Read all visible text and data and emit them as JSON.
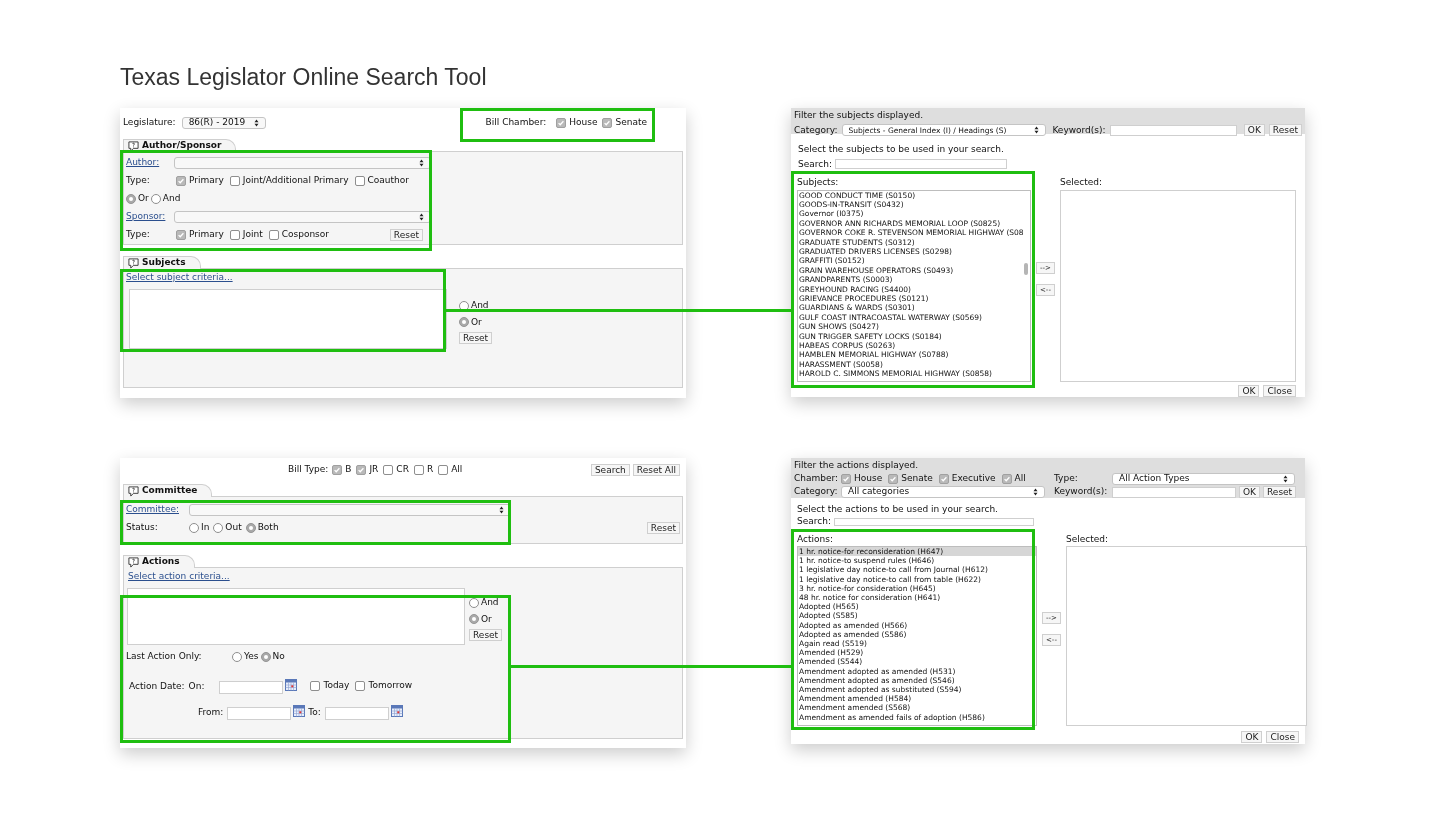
{
  "title": "Texas Legislator Online Search Tool",
  "search_form": {
    "legislature_label": "Legislature:",
    "legislature_value": "86(R) - 2019",
    "bill_chamber_label": "Bill Chamber:",
    "bill_chambers": [
      {
        "label": "House",
        "checked": true
      },
      {
        "label": "Senate",
        "checked": true
      }
    ],
    "author_sponsor": {
      "tab": "Author/Sponsor",
      "author_label": "Author:",
      "author_type_label": "Type:",
      "author_types": [
        {
          "label": "Primary",
          "checked": true
        },
        {
          "label": "Joint/Additional Primary",
          "checked": false
        },
        {
          "label": "Coauthor",
          "checked": false
        }
      ],
      "logic": [
        {
          "label": "Or",
          "selected": true
        },
        {
          "label": "And",
          "selected": false
        }
      ],
      "sponsor_label": "Sponsor:",
      "sponsor_type_label": "Type:",
      "sponsor_types": [
        {
          "label": "Primary",
          "checked": true
        },
        {
          "label": "Joint",
          "checked": false
        },
        {
          "label": "Cosponsor",
          "checked": false
        }
      ],
      "reset": "Reset"
    },
    "subjects": {
      "tab": "Subjects",
      "link": "Select subject criteria...",
      "logic": [
        {
          "label": "And",
          "selected": false
        },
        {
          "label": "Or",
          "selected": true
        }
      ],
      "reset": "Reset"
    }
  },
  "subjects_dialog": {
    "filter_title": "Filter the subjects displayed.",
    "category_label": "Category:",
    "category_value": "Subjects - General Index (I) / Headings (S)",
    "keyword_label": "Keyword(s):",
    "filter_ok": "OK",
    "filter_reset": "Reset",
    "instruction": "Select the subjects to be used in your search.",
    "search_label": "Search:",
    "list_label": "Subjects:",
    "items": [
      {
        "label": "GOOD CONDUCT TIME (S0150)",
        "selected": false
      },
      {
        "label": "GOODS-IN-TRANSIT (S0432)",
        "selected": false
      },
      {
        "label": "Governor (I0375)",
        "selected": false
      },
      {
        "label": "GOVERNOR ANN RICHARDS MEMORIAL LOOP (S0825)",
        "selected": false
      },
      {
        "label": "GOVERNOR COKE R. STEVENSON MEMORIAL HIGHWAY (S08",
        "selected": false
      },
      {
        "label": "GRADUATE STUDENTS (S0312)",
        "selected": false
      },
      {
        "label": "GRADUATED DRIVERS LICENSES (S0298)",
        "selected": false
      },
      {
        "label": "GRAFFITI (S0152)",
        "selected": false
      },
      {
        "label": "GRAIN WAREHOUSE OPERATORS (S0493)",
        "selected": false
      },
      {
        "label": "GRANDPARENTS (S0003)",
        "selected": false
      },
      {
        "label": "GREYHOUND RACING (S4400)",
        "selected": false
      },
      {
        "label": "GRIEVANCE PROCEDURES (S0121)",
        "selected": false
      },
      {
        "label": "GUARDIANS & WARDS (S0301)",
        "selected": false
      },
      {
        "label": "GULF COAST INTRACOASTAL WATERWAY (S0569)",
        "selected": false
      },
      {
        "label": "GUN SHOWS (S0427)",
        "selected": false
      },
      {
        "label": "GUN TRIGGER SAFETY LOCKS (S0184)",
        "selected": false
      },
      {
        "label": "HABEAS CORPUS (S0263)",
        "selected": false
      },
      {
        "label": "HAMBLEN MEMORIAL HIGHWAY (S0788)",
        "selected": false
      },
      {
        "label": "HARASSMENT (S0058)",
        "selected": false
      },
      {
        "label": "HAROLD C. SIMMONS MEMORIAL HIGHWAY (S0858)",
        "selected": false
      }
    ],
    "add": "-->",
    "remove": "<--",
    "selected_label": "Selected:",
    "ok": "OK",
    "close": "Close"
  },
  "search_form_lower": {
    "bill_type_label": "Bill Type:",
    "bill_types": [
      {
        "label": "B",
        "checked": true
      },
      {
        "label": "JR",
        "checked": true
      },
      {
        "label": "CR",
        "checked": false
      },
      {
        "label": "R",
        "checked": false
      },
      {
        "label": "All",
        "checked": false
      }
    ],
    "search": "Search",
    "reset_all": "Reset All",
    "committee": {
      "tab": "Committee",
      "label": "Committee:",
      "status_label": "Status:",
      "status": [
        {
          "label": "In",
          "selected": false
        },
        {
          "label": "Out",
          "selected": false
        },
        {
          "label": "Both",
          "selected": true
        }
      ],
      "reset": "Reset"
    },
    "actions": {
      "tab": "Actions",
      "link": "Select action criteria...",
      "logic": [
        {
          "label": "And",
          "selected": false
        },
        {
          "label": "Or",
          "selected": true
        }
      ],
      "reset": "Reset",
      "last_action_label": "Last Action Only:",
      "last_action": [
        {
          "label": "Yes",
          "selected": false
        },
        {
          "label": "No",
          "selected": true
        }
      ],
      "date_label": "Action Date:",
      "on_label": "On:",
      "today": {
        "label": "Today",
        "checked": false
      },
      "tomorrow": {
        "label": "Tomorrow",
        "checked": false
      },
      "from_label": "From:",
      "to_label": "To:"
    }
  },
  "actions_dialog": {
    "filter_title": "Filter the actions displayed.",
    "chamber_label": "Chamber:",
    "chambers": [
      {
        "label": "House",
        "checked": true
      },
      {
        "label": "Senate",
        "checked": true
      },
      {
        "label": "Executive",
        "checked": true
      },
      {
        "label": "All",
        "checked": true
      }
    ],
    "type_label": "Type:",
    "type_value": "All Action Types",
    "category_label": "Category:",
    "category_value": "All categories",
    "keyword_label": "Keyword(s):",
    "filter_ok": "OK",
    "filter_reset": "Reset",
    "instruction": "Select the actions to be used in your search.",
    "search_label": "Search:",
    "list_label": "Actions:",
    "items": [
      {
        "label": "1 hr. notice-for reconsideration (H647)",
        "selected": true
      },
      {
        "label": "1 hr. notice-to suspend rules (H646)",
        "selected": false
      },
      {
        "label": "1 legislative day notice-to call from Journal (H612)",
        "selected": false
      },
      {
        "label": "1 legislative day notice-to call from table (H622)",
        "selected": false
      },
      {
        "label": "3 hr. notice-for consideration (H645)",
        "selected": false
      },
      {
        "label": "48 hr. notice for consideration (H641)",
        "selected": false
      },
      {
        "label": "Adopted (H565)",
        "selected": false
      },
      {
        "label": "Adopted (S585)",
        "selected": false
      },
      {
        "label": "Adopted as amended (H566)",
        "selected": false
      },
      {
        "label": "Adopted as amended (S586)",
        "selected": false
      },
      {
        "label": "Again read (S519)",
        "selected": false
      },
      {
        "label": "Amended (H529)",
        "selected": false
      },
      {
        "label": "Amended (S544)",
        "selected": false
      },
      {
        "label": "Amendment adopted as amended (H531)",
        "selected": false
      },
      {
        "label": "Amendment adopted as amended (S546)",
        "selected": false
      },
      {
        "label": "Amendment adopted as substituted (S594)",
        "selected": false
      },
      {
        "label": "Amendment amended (H584)",
        "selected": false
      },
      {
        "label": "Amendment amended (S568)",
        "selected": false
      },
      {
        "label": "Amendment as amended fails of adoption (H586)",
        "selected": false
      }
    ],
    "add": "-->",
    "remove": "<--",
    "selected_label": "Selected:",
    "ok": "OK",
    "close": "Close"
  }
}
